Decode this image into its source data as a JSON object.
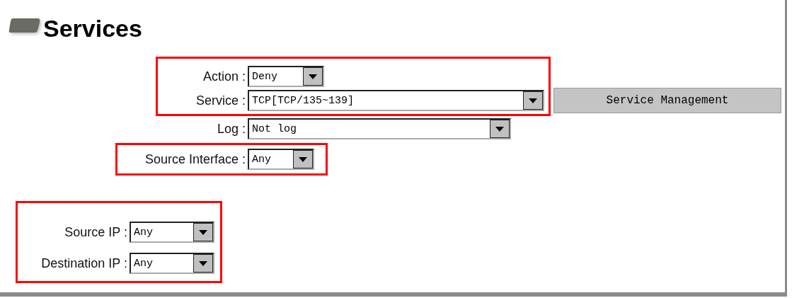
{
  "title": "Services",
  "groups": [
    {
      "highlighted": true,
      "fields": [
        {
          "label": "Action :",
          "value": "Deny"
        },
        {
          "label": "Service :",
          "value": "TCP[TCP/135~139]"
        }
      ]
    },
    {
      "highlighted": false,
      "fields": [
        {
          "label": "Log :",
          "value": "Not log"
        }
      ]
    },
    {
      "highlighted": true,
      "fields": [
        {
          "label": "Source Interface :",
          "value": "Any"
        }
      ]
    },
    {
      "highlighted": true,
      "fields": [
        {
          "label": "Source IP :",
          "value": "Any"
        },
        {
          "label": "Destination IP :",
          "value": "Any"
        }
      ]
    }
  ],
  "service_management_button": "Service Management"
}
